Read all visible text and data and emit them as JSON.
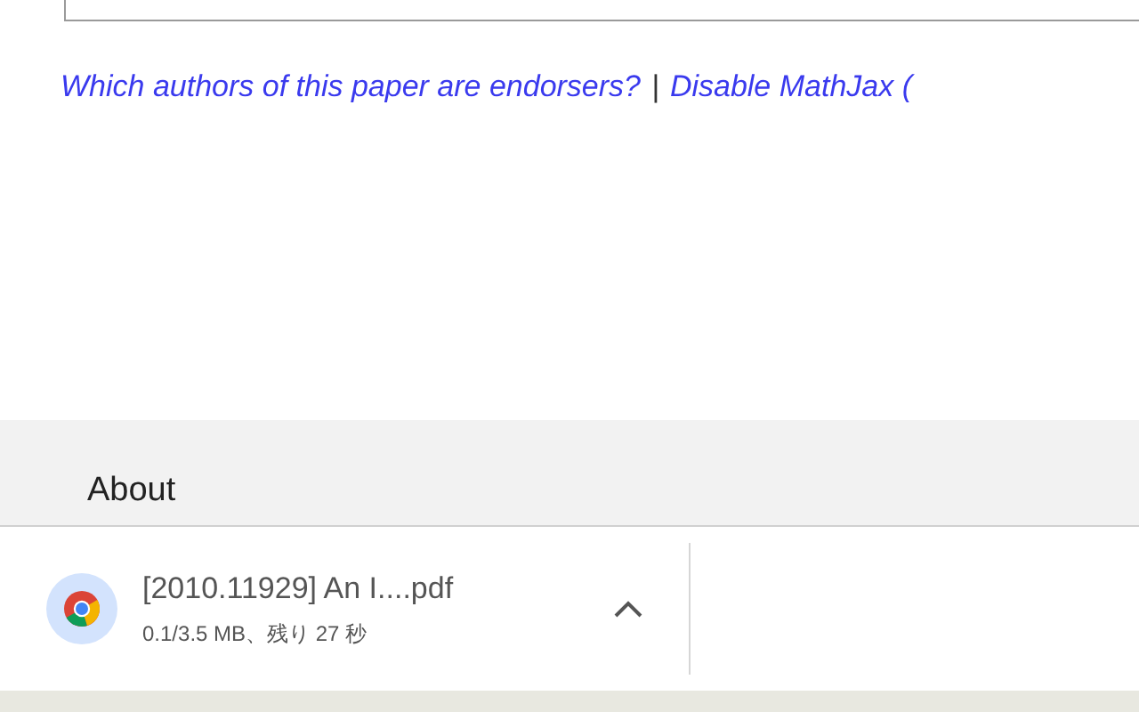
{
  "links": [
    {
      "text": "Which authors of this paper are endorsers?"
    },
    {
      "text": "Disable MathJax ("
    }
  ],
  "separator": "|",
  "footer": {
    "link": "About"
  },
  "download": {
    "filename": "[2010.11929] An I....pdf",
    "status": "0.1/3.5 MB、残り 27 秒"
  }
}
